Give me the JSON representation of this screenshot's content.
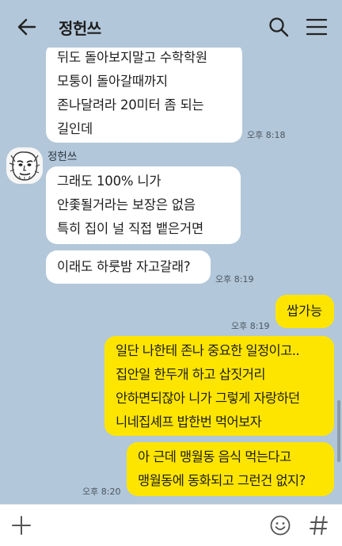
{
  "header": {
    "title": "정헌쓰",
    "back_icon": "arrow-left-icon",
    "search_icon": "search-icon",
    "menu_icon": "hamburger-menu-icon"
  },
  "messages": [
    {
      "sender": "other",
      "text": "뒤도 돌아보지말고 수학학원\n모퉁이 돌아갈때까지\n존나달려라 20미터 좀 되는\n길인데",
      "time": "오후 8:18"
    },
    {
      "sender_name": "정헌쓰",
      "sender": "other",
      "text": "그래도 100% 니가\n안좇될거라는 보장은 없음\n특히 집이 널 직접 뱉은거면"
    },
    {
      "sender": "other",
      "text": "이래도 하룻밤 자고갈래?",
      "time": "오후 8:19"
    },
    {
      "sender": "me",
      "text": "쌉가능",
      "time": "오후 8:19"
    },
    {
      "sender": "me",
      "text": "일단 나한테 존나 중요한 일정이고..\n집안일 한두개 하고 삽짓거리\n안하면되잖아 니가 그렇게 자랑하던\n니네집셰프 밥한번 먹어보자"
    },
    {
      "sender": "me",
      "text": "아 근데 맹월동 음식 먹는다고\n맹월동에 동화되고 그런건 없지?",
      "time": "오후 8:20"
    }
  ],
  "input_bar": {
    "plus_icon": "plus-icon",
    "emoji_icon": "emoji-icon",
    "hash_icon": "hashtag-icon"
  },
  "colors": {
    "background": "#b2c7d9",
    "incoming_bubble": "#ffffff",
    "outgoing_bubble": "#fee500"
  }
}
